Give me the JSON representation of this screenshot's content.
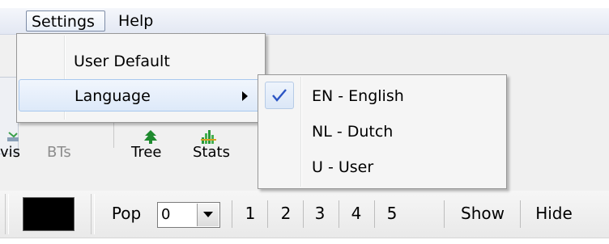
{
  "menubar": {
    "items": [
      {
        "label": "Settings"
      },
      {
        "label": "Help"
      }
    ]
  },
  "toolbar": {
    "buttons": [
      {
        "label": "vis",
        "enabled": true
      },
      {
        "label": "BTs",
        "enabled": false
      },
      {
        "label": "Tree",
        "icon": "tree-icon"
      },
      {
        "label": "Stats",
        "icon": "stats-icon"
      }
    ]
  },
  "bottombar": {
    "color_swatch": "#000000",
    "pop_label": "Pop",
    "pop_value": "0",
    "numbers": [
      "1",
      "2",
      "3",
      "4",
      "5"
    ],
    "show_label": "Show",
    "hide_label": "Hide"
  },
  "settings_menu": {
    "items": [
      {
        "label": "User Default"
      },
      {
        "label": "Language",
        "has_submenu": true
      }
    ]
  },
  "language_submenu": {
    "items": [
      {
        "label": "EN - English",
        "checked": true
      },
      {
        "label": "NL - Dutch",
        "checked": false
      },
      {
        "label": "U - User",
        "checked": false
      }
    ]
  },
  "colors": {
    "accent": "#3a6fd8",
    "highlight_border": "#a8c8ee"
  }
}
